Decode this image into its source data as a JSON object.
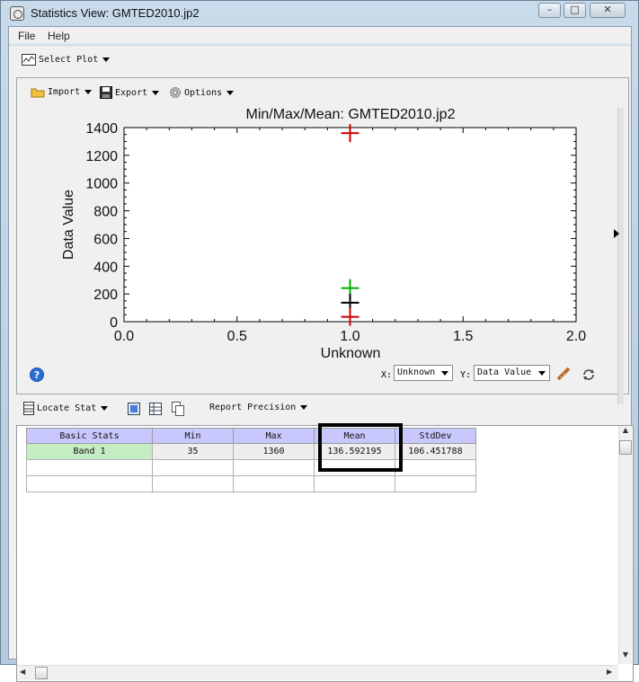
{
  "window": {
    "title": "Statistics View: GMTED2010.jp2"
  },
  "menu": {
    "file": "File",
    "help": "Help"
  },
  "toolbar": {
    "select_plot": "Select Plot"
  },
  "plot_toolbar": {
    "import": "Import",
    "export": "Export",
    "options": "Options"
  },
  "chart_data": {
    "type": "scatter",
    "title": "Min/Max/Mean: GMTED2010.jp2",
    "xlabel": "Unknown",
    "ylabel": "Data Value",
    "xlim": [
      0,
      2
    ],
    "ylim": [
      0,
      1400
    ],
    "xticks": [
      "0.0",
      "0.5",
      "1.0",
      "1.5",
      "2.0"
    ],
    "yticks": [
      "0",
      "200",
      "400",
      "600",
      "800",
      "1000",
      "1200",
      "1400"
    ],
    "series": [
      {
        "values": [
          {
            "x": 1.0,
            "y": 1360
          }
        ],
        "color": "#cc0000"
      },
      {
        "values": [
          {
            "x": 1.0,
            "y": 242.6
          }
        ],
        "color": "#00aa00"
      },
      {
        "values": [
          {
            "x": 1.0,
            "y": 136.6
          }
        ],
        "color": "#000000"
      },
      {
        "values": [
          {
            "x": 1.0,
            "y": 35
          }
        ],
        "color": "#cc0000"
      }
    ],
    "marker": "plus",
    "grid": false
  },
  "axis_selectors": {
    "x_label": "X:",
    "x_value": "Unknown",
    "y_label": "Y:",
    "y_value": "Data Value"
  },
  "stats_toolbar": {
    "locate_stat": "Locate Stat",
    "report_precision": "Report Precision"
  },
  "table": {
    "headers": [
      "Basic Stats",
      "Min",
      "Max",
      "Mean",
      "StdDev"
    ],
    "rows": [
      [
        "Band 1",
        "35",
        "1360",
        "136.592195",
        "106.451788"
      ],
      [
        "",
        "",
        "",
        "",
        ""
      ],
      [
        "",
        "",
        "",
        "",
        ""
      ]
    ]
  }
}
